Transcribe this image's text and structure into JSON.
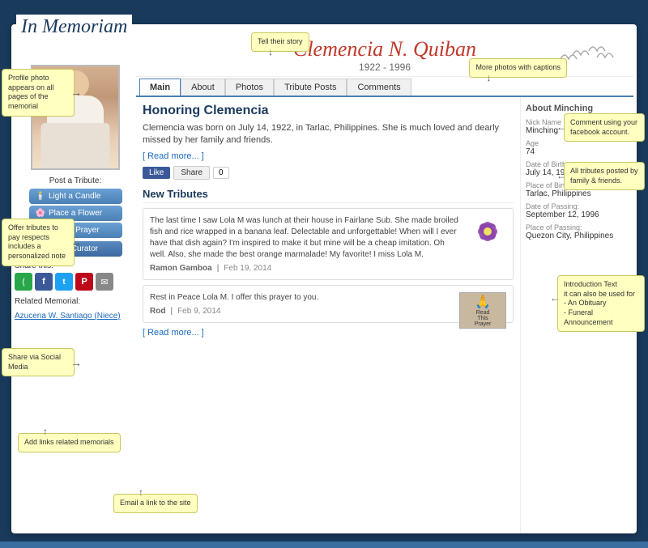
{
  "page": {
    "title": "In Memoriam",
    "background_color": "#1a3a5c"
  },
  "header": {
    "person_name": "Clemencia N. Quiban",
    "years": "1922 - 1996"
  },
  "tabs": [
    {
      "label": "Main",
      "active": true
    },
    {
      "label": "About",
      "active": false
    },
    {
      "label": "Photos",
      "active": false
    },
    {
      "label": "Tribute Posts",
      "active": false
    },
    {
      "label": "Comments",
      "active": false
    }
  ],
  "main_section": {
    "title": "Honoring Clemencia",
    "text": "Clemencia was born on July 14, 1922, in Tarlac, Philippines. She is much loved and dearly missed by her family and friends.",
    "read_more": "[ Read more... ]",
    "fb_like": "Like",
    "fb_share": "Share",
    "fb_count": "0"
  },
  "about_section": {
    "title": "About Minching",
    "nickname_label": "Nick Name",
    "nickname": "Minching",
    "age_label": "Age",
    "age": "74",
    "dob_label": "Date of Birth:",
    "dob": "July 14, 1922",
    "pob_label": "Place of Birth:",
    "pob": "Tarlac, Philippines",
    "dop_label": "Date of Passing:",
    "dop": "September 12, 1996",
    "pop_label": "Place of Passing:",
    "pop": "Quezon City, Philippines"
  },
  "tribute_section": {
    "label": "Post a Tribute:",
    "buttons": [
      {
        "label": "Light a Candle",
        "icon": "🕯️"
      },
      {
        "label": "Place a Flower",
        "icon": "🌸"
      },
      {
        "label": "Offer a Prayer",
        "icon": "🙏"
      }
    ],
    "email_btn": "Email Curator"
  },
  "share_section": {
    "label": "Share this:",
    "icons": [
      {
        "name": "share",
        "symbol": "⟨"
      },
      {
        "name": "facebook",
        "symbol": "f"
      },
      {
        "name": "twitter",
        "symbol": "t"
      },
      {
        "name": "pinterest",
        "symbol": "p"
      },
      {
        "name": "email",
        "symbol": "✉"
      }
    ]
  },
  "related": {
    "label": "Related Memorial:",
    "link": "Azucena W. Santiago (Niece)"
  },
  "new_tributes": {
    "title": "New Tributes",
    "tributes": [
      {
        "text": "The last time I saw Lola M was lunch at their house in Fairlane Sub. She made broiled fish and rice wrapped in a banana leaf. Delectable and unforgettable! When will I ever have that dish again? I'm inspired to make it but mine will be a cheap imitation. Oh well. Also, she made the best orange marmalade! My favorite! I miss Lola M.",
        "author": "Ramon Gamboa",
        "date": "Feb 19, 2014",
        "has_flower": true
      },
      {
        "text": "Rest in Peace Lola M. I offer this prayer to you.",
        "author": "Rod",
        "date": "Feb 9, 2014",
        "has_prayer": true
      }
    ],
    "read_more": "[ Read more... ]"
  },
  "callouts": [
    {
      "id": "profile-photo",
      "text": "Profile photo\nappears on all pages\nof the memorial"
    },
    {
      "id": "offer-tributes",
      "text": "Offer tributes to pay\nrespects includes a\npersonalized note"
    },
    {
      "id": "share-social",
      "text": "Share via Social Media"
    },
    {
      "id": "add-links",
      "text": "Add links related memorials"
    },
    {
      "id": "email-link",
      "text": "Email a link to the site"
    },
    {
      "id": "tell-story",
      "text": "Tell their story"
    },
    {
      "id": "more-photos",
      "text": "More photos\nwith captions"
    },
    {
      "id": "comment-fb",
      "text": "Comment using your\nfacebook account."
    },
    {
      "id": "all-tributes",
      "text": "All tributes posted\nby family & friends."
    },
    {
      "id": "intro-text",
      "text": "Introduction Text\nit can also be used for\n- An Obituary\n- Funeral Announcement"
    }
  ]
}
